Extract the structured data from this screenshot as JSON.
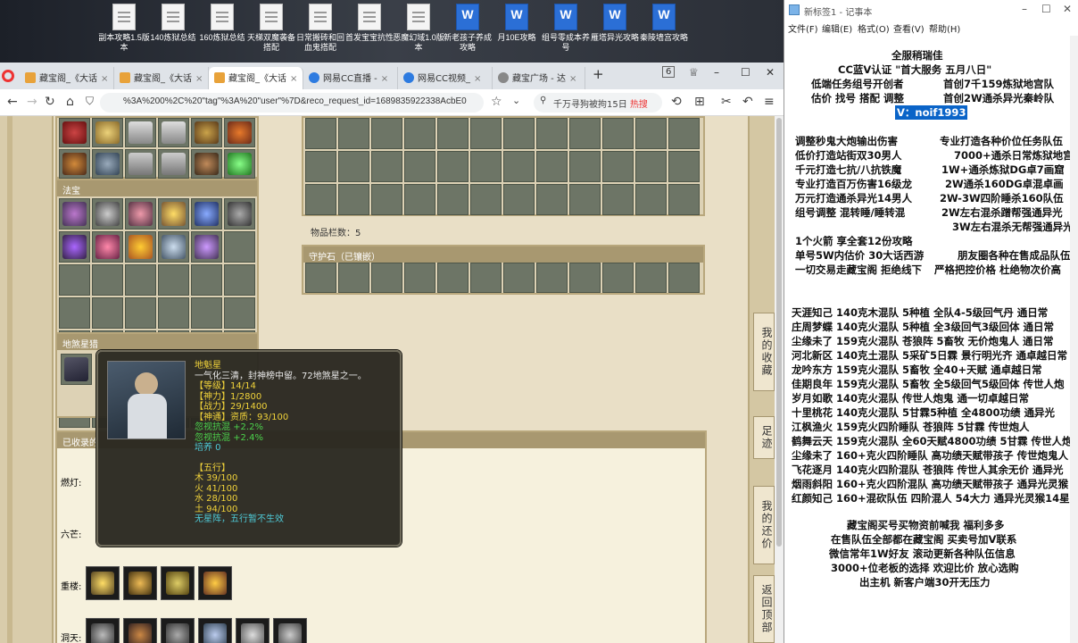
{
  "desktop": {
    "icons": [
      {
        "label": "副本攻略1.5版本",
        "type": "txt"
      },
      {
        "label": "140炼狱总结",
        "type": "txt"
      },
      {
        "label": "160炼狱总结",
        "type": "txt"
      },
      {
        "label": "天梯双魔袭备搭配",
        "type": "txt"
      },
      {
        "label": "日常搬砖和回血鬼搭配",
        "type": "txt"
      },
      {
        "label": "首发宝宝抗性",
        "type": "txt"
      },
      {
        "label": "恶魔幻域1.0版本",
        "type": "txt"
      },
      {
        "label": "新老孩子养成攻略",
        "type": "word"
      },
      {
        "label": "月10E攻略",
        "type": "word"
      },
      {
        "label": "组号零成本养号",
        "type": "word"
      },
      {
        "label": "雁塔异光攻略",
        "type": "word"
      },
      {
        "label": "秦陵墙宫攻略",
        "type": "word"
      }
    ]
  },
  "browser": {
    "tabs": [
      {
        "label": "藏宝阁_《大话",
        "active": false
      },
      {
        "label": "藏宝阁_《大话",
        "active": false
      },
      {
        "label": "藏宝阁_《大话",
        "active": true
      },
      {
        "label": "网易CC直播 -",
        "active": false
      },
      {
        "label": "网易CC视频_",
        "active": false
      },
      {
        "label": "藏宝广场 - 达",
        "active": false
      }
    ],
    "tab_count": "6",
    "url": "%3A%200%2C%20\"tag\"%3A%20\"user\"%7D&reco_request_id=1689835922338AcbE0",
    "search_text": "千万寻狗被拘15日",
    "search_hot": "热搜"
  },
  "game": {
    "fabao_title": "法宝",
    "dishaxing_title": "地煞星猎",
    "collected_title": "已收录的",
    "items_count_label": "物品栏数：5",
    "guardian_title": "守护石（已镶嵌）",
    "slot_labels": [
      "燃灯:",
      "六芒:",
      "重楼:",
      "洞天:"
    ],
    "right_buttons": [
      "我的收藏",
      "足迹",
      "我的还价",
      "返回顶部"
    ],
    "tooltip": {
      "name": "地魁星",
      "desc": "一气化三清，封神榜中留。72地煞星之一。",
      "level": "【等级】14/14",
      "shenli": "【神力】1/2800",
      "zhanli": "【战力】29/1400",
      "shentong": "【神通】资质：93/100",
      "kang1": "忽视抗混 +2.2%",
      "kang2": "忽视抗混 +2.4%",
      "peiyang": "培养 0",
      "wuxing_title": "【五行】",
      "mu": "木 39/100",
      "huo": "火 41/100",
      "shui": "水 28/100",
      "tu": "土 94/100",
      "note": "无星阵，五行暂不生效"
    }
  },
  "notepad": {
    "title": "新标签1 - 记事本",
    "menu": [
      "文件(F)",
      "编辑(E)",
      "格式(O)",
      "查看(V)",
      "帮助(H)"
    ],
    "lines": [
      "全服稍瑞佳",
      "CC蓝V认证 \"首大服务 五月八日\"",
      "低端任务组号开创者",
      "首创7千159炼狱地宫队",
      "估价 找号 搭配 调整",
      "首创2W通杀异光秦岭队",
      "V：noif1993",
      "调整秒鬼大炮输出伤害",
      "专业打造各种价位任务队伍",
      "低价打造站街双30男人",
      "7000+通杀日常炼狱地宫",
      "千元打造七抗/八抗铁魔",
      "1W+通杀炼狱DG卓7画窟",
      "专业打造百万伤害16级龙",
      "2W通杀160DG卓混卓画",
      "万元打造通杀异光14男人",
      "2W-3W四阶睡杀160队伍",
      "组号调整 混转睡/睡转混",
      "2W左右混杀蹭帮强通异光",
      "3W左右混杀无帮强通异光",
      "1个火箭 享全套12份攻略",
      "单号5W内估价 30大话西游",
      "朋友圈各种在售成品队伍",
      "一切交易走藏宝阁 拒绝线下",
      "严格把控价格 杜绝物次价高",
      "天涯知己 140克木混队 5种植 全队4-5级回气丹 通日常",
      "庄周梦蝶 140克火混队 5种植 全3级回气3级回体 通日常",
      "尘缘未了 159克火混队 苍狼阵 5畜牧 无价炮鬼人 通日常",
      "河北新区 140克土混队 5采矿5日霖 景行明光齐 通卓越日常",
      "龙吟东方 159克火混队 5畜牧 全40+天赋 通卓越日常",
      "佳期良年 159克火混队 5畜牧 全5级回气5级回体 传世人炮",
      "岁月如歌 140克火混队 传世人炮鬼 通一切卓越日常",
      "十里桃花 140克火混队 5甘霖5种植 全4800功绩 通异光",
      "江枫渔火 159克火四阶睡队 苍狼阵 5甘霖 传世炮人",
      "鹤舞云天 159克火混队 全60天赋4800功绩 5甘霖 传世人炮",
      "尘缘未了 160+克火四阶睡队 高功绩天赋带孩子 传世炮鬼人",
      "飞花逐月 140克火四阶混队 苍狼阵 传世人其余无价 通异光",
      "烟雨斜阳 160+克火四阶混队 高功绩天赋带孩子 通异光灵猴",
      "红颜知己 160+混砍队伍 四阶混人 54大力 通异光灵猴14星",
      "藏宝阁买号买物资前喊我 福利多多",
      "在售队伍全部都在藏宝阁 买卖号加V联系",
      "微信常年1W好友 滚动更新各种队伍信息",
      "3000+位老板的选择 欢迎比价 放心选购",
      "出主机 新客户端30开无压力"
    ]
  },
  "colors": {
    "page_bg": "#e9dfc6",
    "panel_border": "#b8a77c",
    "selection": "#0a64c8",
    "tooltip_yellow": "#f0d23a",
    "tooltip_green": "#4cd24c"
  }
}
